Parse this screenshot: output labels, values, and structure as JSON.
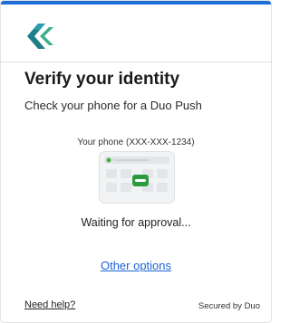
{
  "header": {
    "logo_icon": "brand-chevron-logo-icon",
    "accent_color": "#1f6fd8",
    "logo_colors": [
      "#1f7f88",
      "#3fae8a"
    ]
  },
  "main": {
    "title": "Verify your identity",
    "subtitle": "Check your phone for a Duo Push",
    "phone_label": "Your phone (XXX-XXX-1234)",
    "illustration_icon": "phone-push-notification-icon",
    "waiting_text": "Waiting for approval...",
    "other_options_label": "Other options",
    "link_color": "#1d64d6"
  },
  "footer": {
    "need_help_label": "Need help?",
    "secured_by_text": "Secured by Duo"
  }
}
